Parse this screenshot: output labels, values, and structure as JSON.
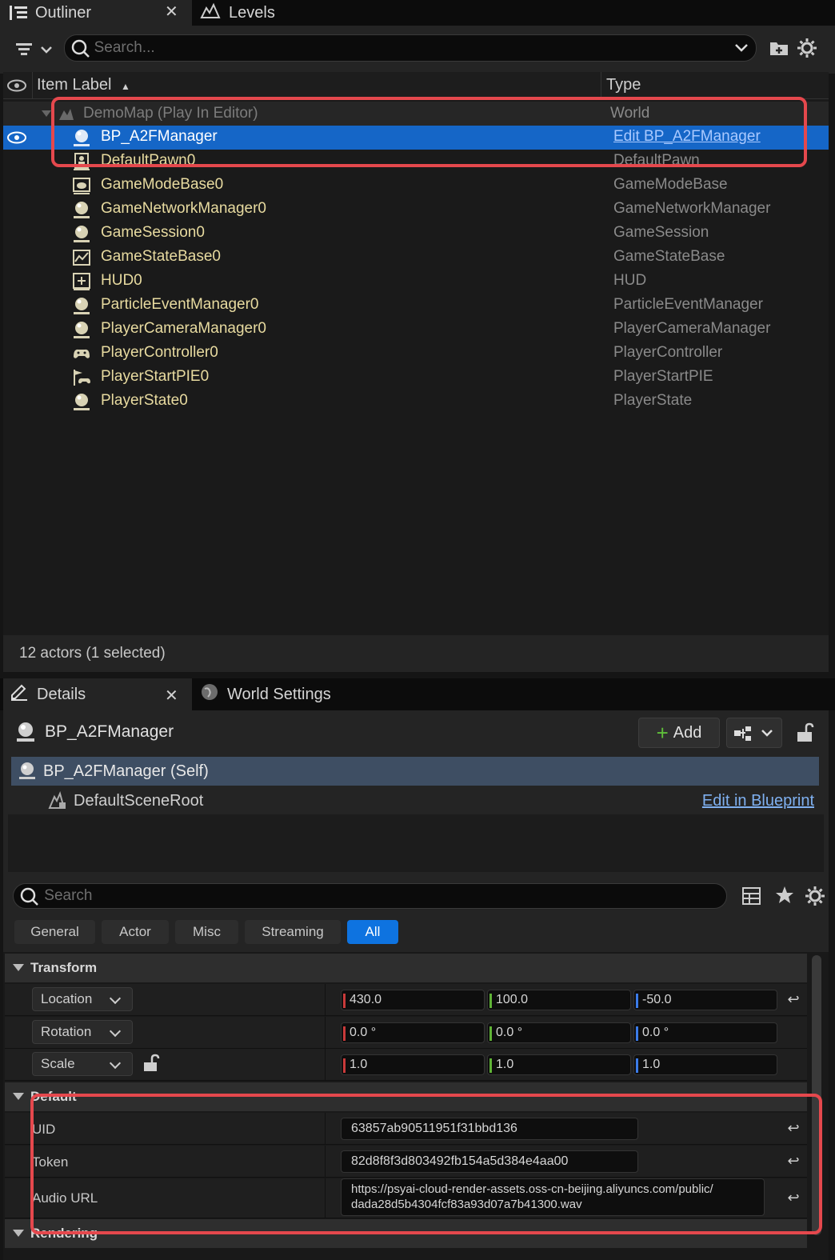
{
  "outliner": {
    "tab_label": "Outliner",
    "levels_tab_label": "Levels",
    "search_placeholder": "Search...",
    "col_item_label": "Item Label",
    "col_type": "Type",
    "world_label": "DemoMap (Play In Editor)",
    "world_type": "World",
    "rows": [
      {
        "label": "BP_A2FManager",
        "type": "Edit BP_A2FManager",
        "icon": "blueprint-actor-icon"
      },
      {
        "label": "DefaultPawn0",
        "type": "DefaultPawn",
        "icon": "pawn-icon"
      },
      {
        "label": "GameModeBase0",
        "type": "GameModeBase",
        "icon": "game-mode-icon"
      },
      {
        "label": "GameNetworkManager0",
        "type": "GameNetworkManager",
        "icon": "actor-icon"
      },
      {
        "label": "GameSession0",
        "type": "GameSession",
        "icon": "actor-icon"
      },
      {
        "label": "GameStateBase0",
        "type": "GameStateBase",
        "icon": "game-state-icon"
      },
      {
        "label": "HUD0",
        "type": "HUD",
        "icon": "hud-icon"
      },
      {
        "label": "ParticleEventManager0",
        "type": "ParticleEventManager",
        "icon": "actor-icon"
      },
      {
        "label": "PlayerCameraManager0",
        "type": "PlayerCameraManager",
        "icon": "actor-icon"
      },
      {
        "label": "PlayerController0",
        "type": "PlayerController",
        "icon": "gamepad-icon"
      },
      {
        "label": "PlayerStartPIE0",
        "type": "PlayerStartPIE",
        "icon": "player-start-icon"
      },
      {
        "label": "PlayerState0",
        "type": "PlayerState",
        "icon": "actor-icon"
      }
    ],
    "status": "12 actors (1 selected)"
  },
  "details": {
    "tab_label": "Details",
    "world_settings_tab_label": "World Settings",
    "actor_name": "BP_A2FManager",
    "add_label": "Add",
    "self_component": "BP_A2FManager (Self)",
    "root_component": "DefaultSceneRoot",
    "edit_in_blueprint": "Edit in Blueprint",
    "search_placeholder": "Search",
    "filters": [
      "General",
      "Actor",
      "Misc",
      "Streaming",
      "All"
    ],
    "transform": {
      "section": "Transform",
      "location_label": "Location",
      "rotation_label": "Rotation",
      "scale_label": "Scale",
      "location": [
        "430.0",
        "100.0",
        "-50.0"
      ],
      "rotation": [
        "0.0 °",
        "0.0 °",
        "0.0 °"
      ],
      "scale": [
        "1.0",
        "1.0",
        "1.0"
      ]
    },
    "default": {
      "section": "Default",
      "uid_label": "UID",
      "uid": "63857ab90511951f31bbd136",
      "token_label": "Token",
      "token": "82d8f8f3d803492fb154a5d384e4aa00",
      "audio_url_label": "Audio URL",
      "audio_url": "https://psyai-cloud-render-assets.oss-cn-beijing.aliyuncs.com/public/\ndada28d5b4304fcf83a93d07a7b41300.wav"
    },
    "rendering_section": "Rendering"
  },
  "colors": {
    "selection": "#1566c7",
    "highlight_box": "#e5484d",
    "actor_label": "#e8dba0",
    "axis_x": "#c93a3a",
    "axis_y": "#5fb336",
    "axis_z": "#3b7be8"
  }
}
